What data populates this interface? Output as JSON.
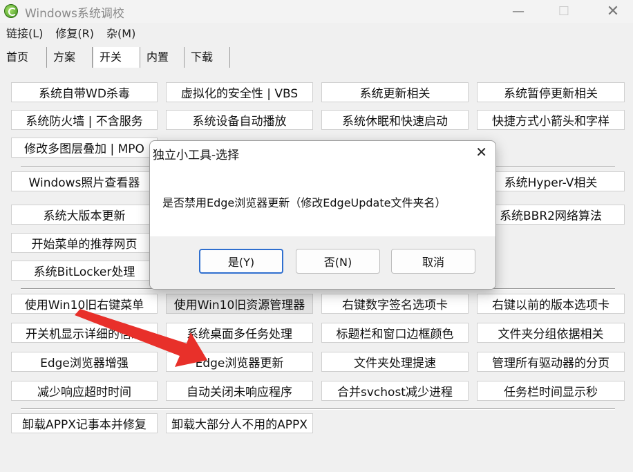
{
  "window": {
    "title": "Windows系统调校"
  },
  "menu": [
    "链接(L)",
    "修复(R)",
    "杂(M)"
  ],
  "tabs": [
    "首页",
    "方案",
    "开关",
    "内置",
    "下载"
  ],
  "active_tab": "开关",
  "buttons": {
    "r1": [
      "系统自带WD杀毒",
      "虚拟化的安全性 | VBS",
      "系统更新相关",
      "系统暂停更新相关"
    ],
    "r2": [
      "系统防火墙 | 不含服务",
      "系统设备自动播放",
      "系统休眠和快速启动",
      "快捷方式小箭头和字样"
    ],
    "r3": [
      "修改多图层叠加 | MPO"
    ],
    "r4": [
      "Windows照片查看器",
      "系统Hyper-V相关"
    ],
    "r5": [
      "系统大版本更新",
      "系统BBR2网络算法"
    ],
    "r6": [
      "开始菜单的推荐网页"
    ],
    "r7": [
      "系统BitLocker处理"
    ],
    "r8": [
      "使用Win10旧右键菜单",
      "使用Win10旧资源管理器",
      "右键数字签名选项卡",
      "右键以前的版本选项卡"
    ],
    "r9": [
      "开关机显示详细的信息",
      "系统桌面多任务处理",
      "标题栏和窗口边框颜色",
      "文件夹分组依据相关"
    ],
    "r10": [
      "Edge浏览器增强",
      "Edge浏览器更新",
      "文件夹处理提速",
      "管理所有驱动器的分页"
    ],
    "r11": [
      "减少响应超时时间",
      "自动关闭未响应程序",
      "合并svchost减少进程",
      "任务栏时间显示秒"
    ],
    "r12": [
      "卸载APPX记事本并修复",
      "卸载大部分人不用的APPX"
    ]
  },
  "dialog": {
    "title": "独立小工具-选择",
    "message": "是否禁用Edge浏览器更新（修改EdgeUpdate文件夹名）",
    "yes": "是(Y)",
    "no": "否(N)",
    "cancel": "取消"
  },
  "annotation": {
    "arrow_color": "#e8302a"
  }
}
